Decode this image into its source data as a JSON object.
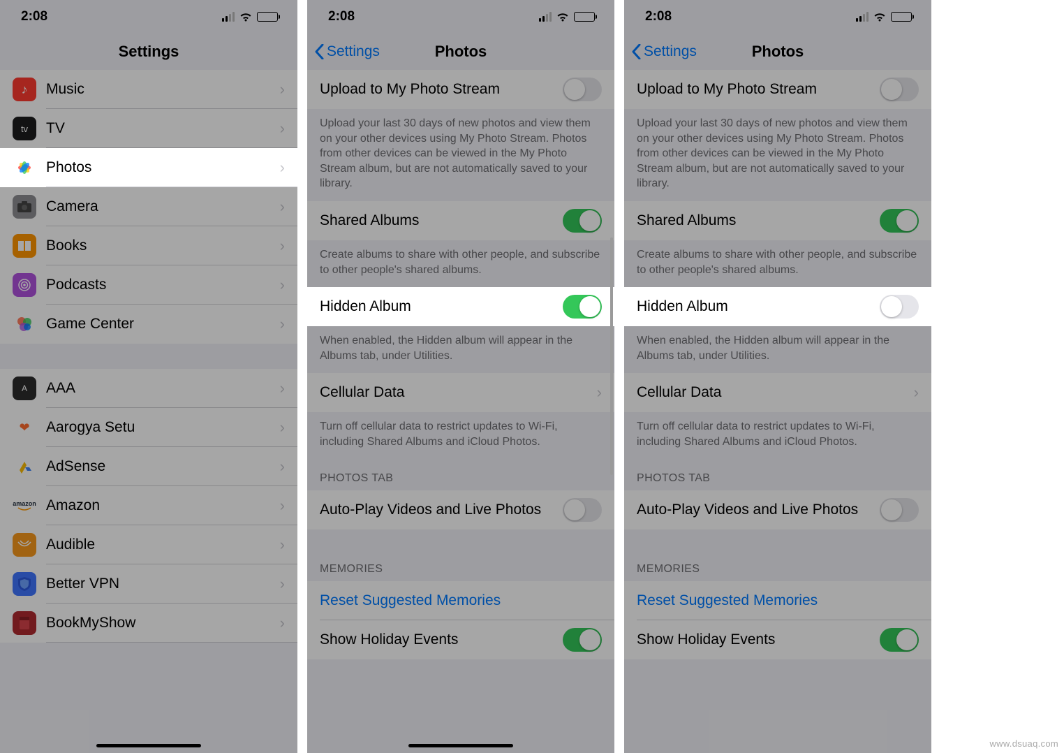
{
  "status": {
    "time": "2:08"
  },
  "screen1": {
    "title": "Settings",
    "items": [
      {
        "label": "Music",
        "icon_bg": "#ff3b30",
        "glyph": "♪"
      },
      {
        "label": "TV",
        "icon_bg": "#1c1c1e",
        "glyph": "tv"
      },
      {
        "label": "Photos",
        "icon_bg": "#ffffff",
        "glyph": "photos",
        "highlighted": true
      },
      {
        "label": "Camera",
        "icon_bg": "#8e8e93",
        "glyph": "📷"
      },
      {
        "label": "Books",
        "icon_bg": "#ff9500",
        "glyph": "📖"
      },
      {
        "label": "Podcasts",
        "icon_bg": "#af52de",
        "glyph": "◉"
      },
      {
        "label": "Game Center",
        "icon_bg": "#ffffff",
        "glyph": "gc"
      }
    ],
    "apps": [
      {
        "label": "AAA",
        "icon_bg": "#2b2b2b"
      },
      {
        "label": "Aarogya Setu",
        "icon_bg": "#ffffff"
      },
      {
        "label": "AdSense",
        "icon_bg": "#ffffff"
      },
      {
        "label": "Amazon",
        "icon_bg": "#ffffff"
      },
      {
        "label": "Audible",
        "icon_bg": "#f8991d"
      },
      {
        "label": "Better VPN",
        "icon_bg": "#3f76ff"
      },
      {
        "label": "BookMyShow",
        "icon_bg": "#b02a30"
      }
    ]
  },
  "photos_settings": {
    "back": "Settings",
    "title": "Photos",
    "upload_stream": {
      "label": "Upload to My Photo Stream",
      "on": false
    },
    "upload_stream_desc": "Upload your last 30 days of new photos and view them on your other devices using My Photo Stream. Photos from other devices can be viewed in the My Photo Stream album, but are not automatically saved to your library.",
    "shared_albums": {
      "label": "Shared Albums",
      "on": true
    },
    "shared_albums_desc": "Create albums to share with other people, and subscribe to other people's shared albums.",
    "hidden_album": {
      "label": "Hidden Album"
    },
    "hidden_album_desc": "When enabled, the Hidden album will appear in the Albums tab, under Utilities.",
    "cellular": {
      "label": "Cellular Data"
    },
    "cellular_desc": "Turn off cellular data to restrict updates to Wi-Fi, including Shared Albums and iCloud Photos.",
    "photos_tab_header": "PHOTOS TAB",
    "autoplay": {
      "label": "Auto-Play Videos and Live Photos",
      "on": false
    },
    "memories_header": "MEMORIES",
    "reset_memories": "Reset Suggested Memories",
    "holiday": {
      "label": "Show Holiday Events",
      "on": true
    }
  },
  "screen2_hidden_on": true,
  "screen3_hidden_on": false,
  "watermark": "www.dsuaq.com"
}
